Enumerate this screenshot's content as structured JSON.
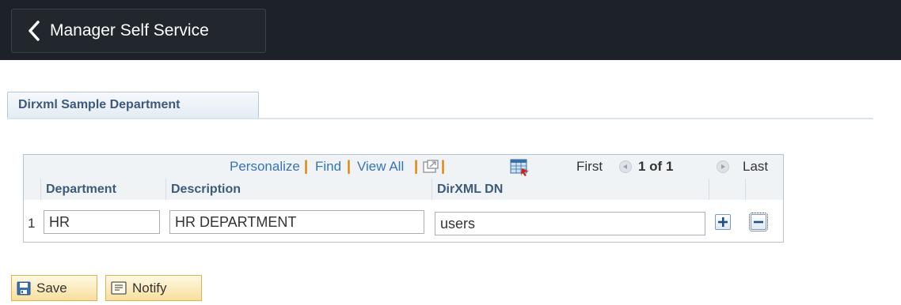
{
  "header": {
    "back_label": "Manager Self Service"
  },
  "tab": {
    "label": "Dirxml Sample Department"
  },
  "grid": {
    "nav": {
      "personalize": "Personalize",
      "find": "Find",
      "view_all": "View All",
      "separator": "|",
      "first": "First",
      "range": "1 of 1",
      "last": "Last"
    },
    "columns": [
      "Department",
      "Description",
      "DirXML DN"
    ],
    "rows": [
      {
        "num": "1",
        "department": "HR",
        "description": "HR DEPARTMENT",
        "dn": "users"
      }
    ]
  },
  "buttons": {
    "save": "Save",
    "notify": "Notify"
  },
  "colors": {
    "topbar": "#1d2229",
    "link": "#3574b8",
    "separator": "#e07f00",
    "header_text": "#3d5a7a",
    "button_bg": "#f7df9c"
  },
  "icons": {
    "back": "chevron-left-icon",
    "zoom": "zoom-icon",
    "grid": "grid-icon",
    "prev": "prev-arrow-icon",
    "next": "next-arrow-icon",
    "add": "plus-icon",
    "delete": "minus-icon",
    "save": "save-icon",
    "notify": "notify-icon"
  }
}
